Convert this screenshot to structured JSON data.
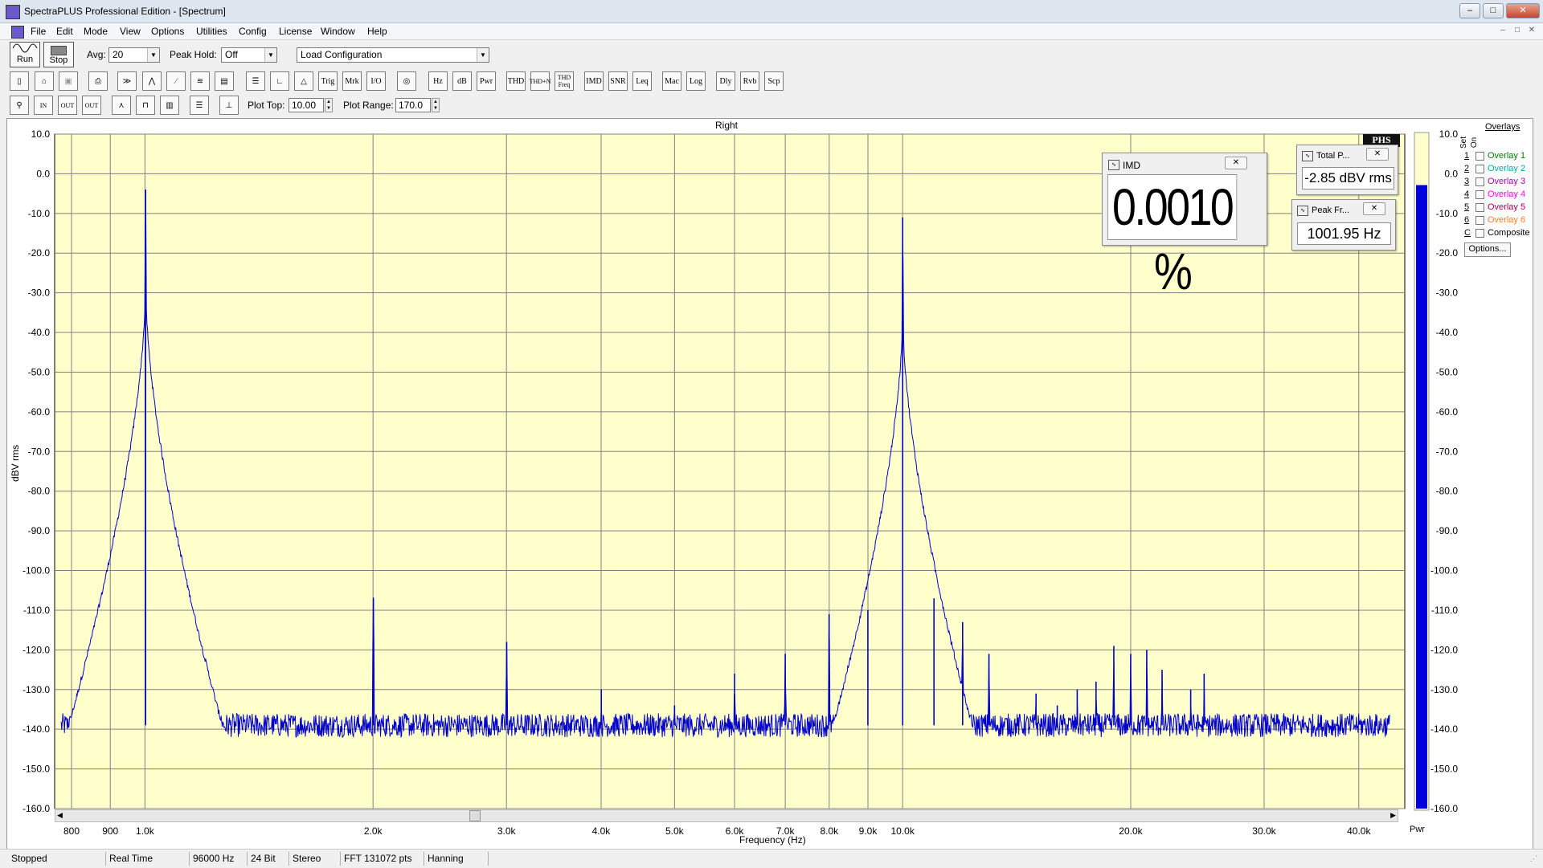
{
  "window": {
    "title": "SpectraPLUS Professional Edition - [Spectrum]",
    "controls": [
      "–",
      "□",
      "✕"
    ],
    "mdi_controls": [
      "–",
      "□",
      "✕"
    ]
  },
  "menu": [
    "File",
    "Edit",
    "Mode",
    "View",
    "Options",
    "Utilities",
    "Config",
    "License",
    "Window",
    "Help"
  ],
  "toolbar1": {
    "run_label": "Run",
    "stop_label": "Stop",
    "avg_label": "Avg:",
    "avg_value": "20",
    "peak_hold_label": "Peak Hold:",
    "peak_hold_value": "Off",
    "config_value": "Load Configuration"
  },
  "toolbar2": {
    "text_buttons": [
      "Trig",
      "Mrk",
      "I/O",
      "Hz",
      "dB",
      "Pwr",
      "THD",
      "THD+N",
      "THD Freq",
      "IMD",
      "SNR",
      "Leq",
      "Mac",
      "Log",
      "Dly",
      "Rvb",
      "Scp"
    ]
  },
  "toolbar3": {
    "plot_top_label": "Plot Top:",
    "plot_top_value": "10.00",
    "plot_range_label": "Plot Range:",
    "plot_range_value": "170.0"
  },
  "plot": {
    "channel_title": "Right",
    "corner_label": "PHS",
    "pwr_label": "Pwr"
  },
  "chart_data": {
    "type": "line",
    "title": "Right",
    "xlabel": "Frequency (Hz)",
    "ylabel": "dBV rms",
    "x_scale": "log",
    "xlim": [
      760,
      46000
    ],
    "ylim": [
      -160,
      10
    ],
    "y_ticks": [
      "10.0",
      "0.0",
      "-10.0",
      "-20.0",
      "-30.0",
      "-40.0",
      "-50.0",
      "-60.0",
      "-70.0",
      "-80.0",
      "-90.0",
      "-100.0",
      "-110.0",
      "-120.0",
      "-130.0",
      "-140.0",
      "-150.0",
      "-160.0"
    ],
    "x_ticks": [
      {
        "v": 800,
        "label": "800"
      },
      {
        "v": 900,
        "label": "900"
      },
      {
        "v": 1000,
        "label": "1.0k"
      },
      {
        "v": 2000,
        "label": "2.0k"
      },
      {
        "v": 3000,
        "label": "3.0k"
      },
      {
        "v": 4000,
        "label": "4.0k"
      },
      {
        "v": 5000,
        "label": "5.0k"
      },
      {
        "v": 6000,
        "label": "6.0k"
      },
      {
        "v": 7000,
        "label": "7.0k"
      },
      {
        "v": 8000,
        "label": "8.0k"
      },
      {
        "v": 9000,
        "label": "9.0k"
      },
      {
        "v": 10000,
        "label": "10.0k"
      },
      {
        "v": 20000,
        "label": "20.0k"
      },
      {
        "v": 30000,
        "label": "30.0k"
      },
      {
        "v": 40000,
        "label": "40.0k"
      }
    ],
    "grid": true,
    "line_color": "#0000cc",
    "background": "#ffffcc",
    "noise_floor": -139,
    "peaks": [
      {
        "f": 1002,
        "db": -4
      },
      {
        "f": 2002,
        "db": -107
      },
      {
        "f": 3002,
        "db": -118
      },
      {
        "f": 4002,
        "db": -130
      },
      {
        "f": 5000,
        "db": -134
      },
      {
        "f": 6000,
        "db": -126
      },
      {
        "f": 7000,
        "db": -121
      },
      {
        "f": 7998,
        "db": -111
      },
      {
        "f": 8998,
        "db": -110
      },
      {
        "f": 10002,
        "db": -11
      },
      {
        "f": 11000,
        "db": -107
      },
      {
        "f": 12000,
        "db": -113
      },
      {
        "f": 13000,
        "db": -121
      },
      {
        "f": 15000,
        "db": -131
      },
      {
        "f": 16000,
        "db": -134
      },
      {
        "f": 17000,
        "db": -130
      },
      {
        "f": 18000,
        "db": -128
      },
      {
        "f": 19000,
        "db": -119
      },
      {
        "f": 20000,
        "db": -121
      },
      {
        "f": 21000,
        "db": -120
      },
      {
        "f": 22000,
        "db": -125
      },
      {
        "f": 24000,
        "db": -130
      },
      {
        "f": 25000,
        "db": -126
      }
    ],
    "pwr_level_db": -2.85
  },
  "imd_window": {
    "title": "IMD",
    "value": "0.0010 %"
  },
  "total_power_window": {
    "title": "Total P...",
    "value": "-2.85 dBV rms"
  },
  "peak_freq_window": {
    "title": "Peak Fr...",
    "value": "1001.95 Hz"
  },
  "overlays": {
    "header": "Overlays",
    "set_label": "Set",
    "on_label": "On",
    "items": [
      {
        "num": "1",
        "label": "Overlay 1",
        "color": "#008000"
      },
      {
        "num": "2",
        "label": "Overlay 2",
        "color": "#00aaaa"
      },
      {
        "num": "3",
        "label": "Overlay 3",
        "color": "#aa00aa"
      },
      {
        "num": "4",
        "label": "Overlay 4",
        "color": "#ff00ff"
      },
      {
        "num": "5",
        "label": "Overlay 5",
        "color": "#aa0055"
      },
      {
        "num": "6",
        "label": "Overlay 6",
        "color": "#ff7f27"
      },
      {
        "num": "C",
        "label": "Composite",
        "color": "#000000"
      }
    ],
    "options_label": "Options..."
  },
  "status": [
    "Stopped",
    "Real Time",
    "96000 Hz",
    "24 Bit",
    "Stereo",
    "FFT 131072 pts",
    "Hanning"
  ]
}
